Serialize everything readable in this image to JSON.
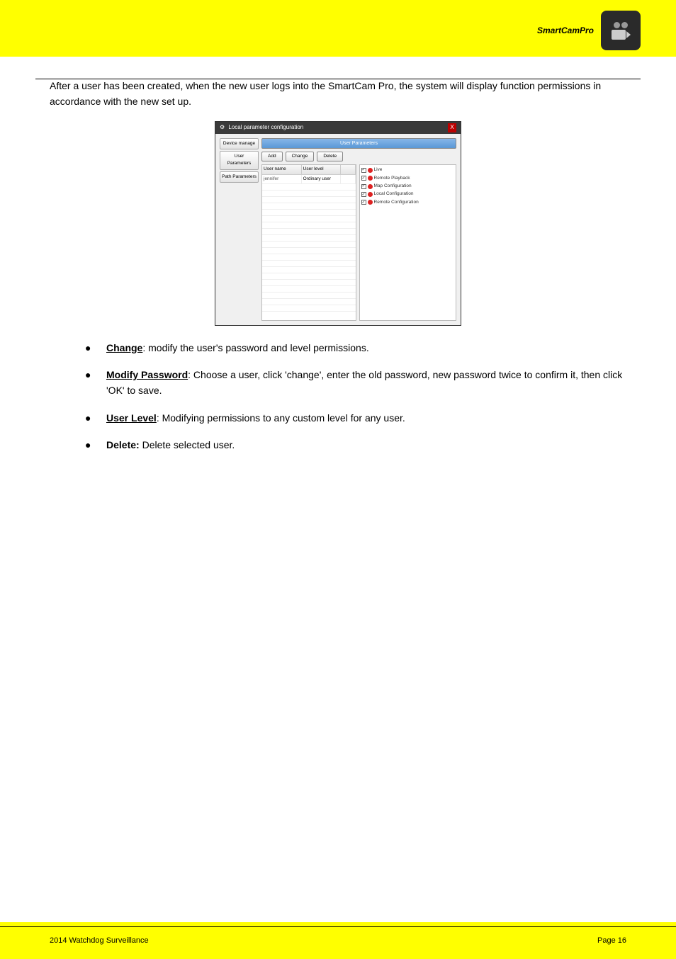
{
  "brand": "SmartCamPro",
  "intro": "After a user has been created, when the new user logs into the SmartCam Pro, the system will display function permissions in accordance with the new set up.",
  "dialog": {
    "title": "Local parameter configuration",
    "gear": "⚙",
    "close": "X",
    "sidebar": {
      "items": [
        "Device manage",
        "User Parameters",
        "Path Parameters"
      ]
    },
    "panel_header": "User Parameters",
    "buttons": {
      "add": "Add",
      "change": "Change",
      "delete": "Delete"
    },
    "table": {
      "columns": [
        "User name",
        "User level",
        ""
      ],
      "rows": [
        {
          "username": "jennifer",
          "level": "Ordinary user"
        }
      ]
    },
    "permissions": [
      "Live",
      "Remote Playback",
      "Map Configuration",
      "Local Configuration",
      "Remote Configuration"
    ],
    "check": "✓"
  },
  "bullets": {
    "change": {
      "heading": "Change",
      "text": "modify the user's password and level permissions."
    },
    "modify_pw": {
      "heading": "Modify Password",
      "text": "Choose a user, click 'change', enter the old password, new password twice to confirm it, then click 'OK' to save."
    },
    "user_level": {
      "heading": "User Level",
      "text": "Modifying permissions to any custom level for any user."
    },
    "delete": {
      "heading": "Delete: ",
      "text": "Delete selected user."
    }
  },
  "footer": {
    "left": "2014 Watchdog Surveillance",
    "right": "Page 16"
  }
}
